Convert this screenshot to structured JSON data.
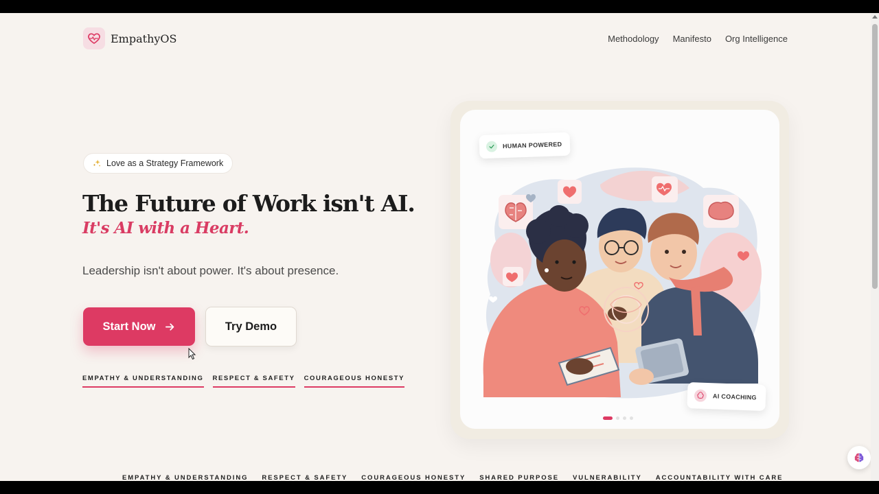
{
  "brand": {
    "name": "EmpathyOS",
    "logo_icon": "heart-pulse-icon",
    "accent": "#dd3a63"
  },
  "nav": {
    "items": [
      "Methodology",
      "Manifesto",
      "Org Intelligence"
    ]
  },
  "hero": {
    "pill": {
      "icon": "sparkles-icon",
      "label": "Love as a Strategy Framework"
    },
    "headline": "The Future of Work isn't AI.",
    "headline_accent": "It's AI with a Heart.",
    "tagline": "Leadership isn't about power. It's about presence.",
    "primary_button": "Start Now",
    "secondary_button": "Try Demo",
    "values": [
      "EMPATHY & UNDERSTANDING",
      "RESPECT & SAFETY",
      "COURAGEOUS HONESTY"
    ]
  },
  "card": {
    "badge_top": "HUMAN POWERED",
    "badge_bottom": "AI COACHING",
    "carousel": {
      "total": 4,
      "active": 1
    }
  },
  "marquee": [
    "EMPATHY & UNDERSTANDING",
    "RESPECT & SAFETY",
    "COURAGEOUS HONESTY",
    "SHARED PURPOSE",
    "VULNERABILITY",
    "ACCOUNTABILITY WITH CARE"
  ],
  "floating_button": {
    "icon": "brain-icon"
  }
}
